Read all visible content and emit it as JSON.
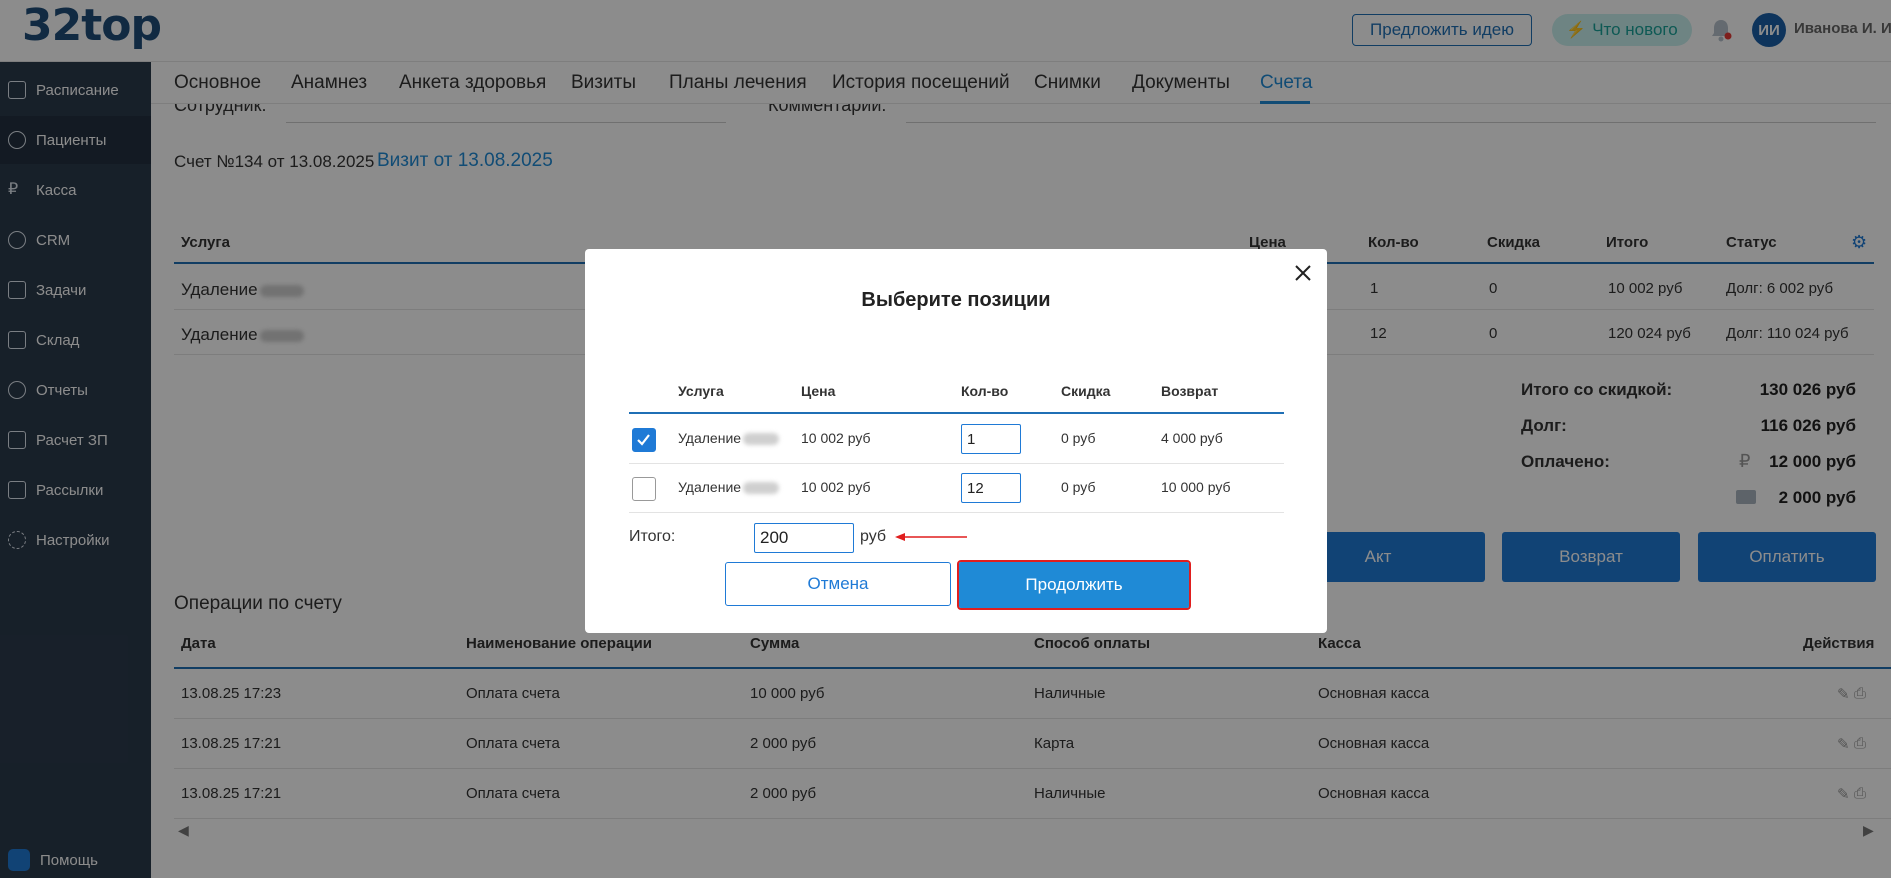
{
  "header": {
    "logo": "32top",
    "idea_button": "Предложить идею",
    "news_button": "Что нового",
    "avatar_initials": "ИИ",
    "user_name": "Иванова И. И."
  },
  "sidebar": {
    "items": [
      {
        "label": "Расписание",
        "icon": "calendar-icon"
      },
      {
        "label": "Пациенты",
        "icon": "user-icon"
      },
      {
        "label": "Касса",
        "icon": "ruble-icon"
      },
      {
        "label": "CRM",
        "icon": "user-icon"
      },
      {
        "label": "Задачи",
        "icon": "tasks-icon"
      },
      {
        "label": "Склад",
        "icon": "warehouse-icon"
      },
      {
        "label": "Отчеты",
        "icon": "chart-pie-icon"
      },
      {
        "label": "Расчет ЗП",
        "icon": "calculator-icon"
      },
      {
        "label": "Рассылки",
        "icon": "mail-icon"
      },
      {
        "label": "Настройки",
        "icon": "gear-icon"
      }
    ],
    "help": "Помощь"
  },
  "tabs": [
    "Основное",
    "Анамнез",
    "Анкета здоровья",
    "Визиты",
    "Планы лечения",
    "История посещений",
    "Снимки",
    "Документы",
    "Счета"
  ],
  "form": {
    "employee_label": "Сотрудник:",
    "comment_label": "Комментарий:"
  },
  "invoice": {
    "title": "Счет №134 от 13.08.2025",
    "visit_link": "Визит от 13.08.2025"
  },
  "services_table": {
    "headers": [
      "Услуга",
      "Цена",
      "Кол-во",
      "Скидка",
      "Итого",
      "Статус"
    ],
    "rows": [
      {
        "service": "Удаление",
        "qty": "1",
        "discount": "0",
        "total": "10 002 руб",
        "status": "Долг: 6 002 руб"
      },
      {
        "service": "Удаление",
        "qty": "12",
        "discount": "0",
        "total": "120 024 руб",
        "status": "Долг: 110 024 руб"
      }
    ]
  },
  "summary": {
    "total_label": "Итого со скидкой:",
    "total_value": "130 026 руб",
    "debt_label": "Долг:",
    "debt_value": "116 026 руб",
    "paid_label": "Оплачено:",
    "paid_cash": "12 000 руб",
    "paid_card": "2 000 руб"
  },
  "action_buttons": {
    "act": "Акт",
    "refund": "Возврат",
    "pay": "Оплатить"
  },
  "operations": {
    "title": "Операции по счету",
    "headers": [
      "Дата",
      "Наименование операции",
      "Сумма",
      "Способ оплаты",
      "Касса",
      "Действия"
    ],
    "rows": [
      {
        "date": "13.08.25 17:23",
        "name": "Оплата счета",
        "sum": "10 000 руб",
        "method": "Наличные",
        "cashbox": "Основная касса"
      },
      {
        "date": "13.08.25 17:21",
        "name": "Оплата счета",
        "sum": "2 000 руб",
        "method": "Карта",
        "cashbox": "Основная касса"
      },
      {
        "date": "13.08.25 17:21",
        "name": "Оплата счета",
        "sum": "2 000 руб",
        "method": "Наличные",
        "cashbox": "Основная касса"
      }
    ]
  },
  "modal": {
    "title": "Выберите позиции",
    "headers": [
      "Услуга",
      "Цена",
      "Кол-во",
      "Скидка",
      "Возврат"
    ],
    "rows": [
      {
        "checked": true,
        "service": "Удаление",
        "price": "10 002 руб",
        "qty": "1",
        "discount": "0 руб",
        "refund": "4 000 руб"
      },
      {
        "checked": false,
        "service": "Удаление",
        "price": "10 002 руб",
        "qty": "12",
        "discount": "0 руб",
        "refund": "10 000 руб"
      }
    ],
    "total_label": "Итого:",
    "total_value": "200",
    "currency": "руб",
    "cancel": "Отмена",
    "continue": "Продолжить"
  },
  "colors": {
    "brand": "#1f4e79",
    "accent": "#1f8ad6",
    "sidebar_bg": "#2b3b4c",
    "highlight": "#e01e1e"
  }
}
